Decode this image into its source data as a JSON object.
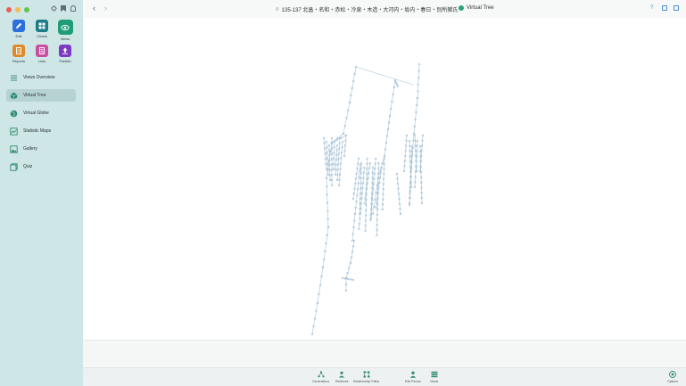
{
  "window": {
    "title": "135-137 北畠・名和・赤松・冷泉・木造・大河内・坂内・春日・別所雑氏",
    "view_name": "Virtual Tree"
  },
  "sidebar": {
    "tiles": [
      {
        "label": "Edit",
        "icon": "pencil-icon",
        "color": "#2d6fdc"
      },
      {
        "label": "Charts",
        "icon": "charts-icon",
        "color": "#1d7b87"
      },
      {
        "label": "Views",
        "icon": "eye-icon",
        "color": "#1f9d77",
        "active": true
      },
      {
        "label": "Reports",
        "icon": "reports-icon",
        "color": "#de8a2a"
      },
      {
        "label": "Lists",
        "icon": "lists-icon",
        "color": "#c94fa0"
      },
      {
        "label": "Publish",
        "icon": "publish-icon",
        "color": "#7b3cc1"
      }
    ],
    "nav": [
      {
        "label": "Views Overview",
        "icon": "list-icon"
      },
      {
        "label": "Virtual Tree",
        "icon": "cube-icon",
        "active": true
      },
      {
        "label": "Virtual Globe",
        "icon": "globe-icon"
      },
      {
        "label": "Statistic Maps",
        "icon": "map-icon"
      },
      {
        "label": "Gallery",
        "icon": "gallery-icon"
      },
      {
        "label": "Quiz",
        "icon": "quiz-icon"
      }
    ]
  },
  "bottombar": {
    "items": [
      {
        "label": "Generations",
        "icon": "generations-icon"
      },
      {
        "label": "Relatives",
        "icon": "relatives-icon"
      },
      {
        "label": "Relationship Paths",
        "icon": "paths-icon"
      },
      {
        "label": "Edit Person",
        "icon": "person-icon"
      },
      {
        "label": "Views",
        "icon": "views-icon"
      }
    ],
    "options_label": "Options"
  },
  "colors": {
    "sidebar_bg": "#cfe6e6",
    "accent_green": "#1f9d77",
    "tree_node": "#a8c4d8"
  }
}
